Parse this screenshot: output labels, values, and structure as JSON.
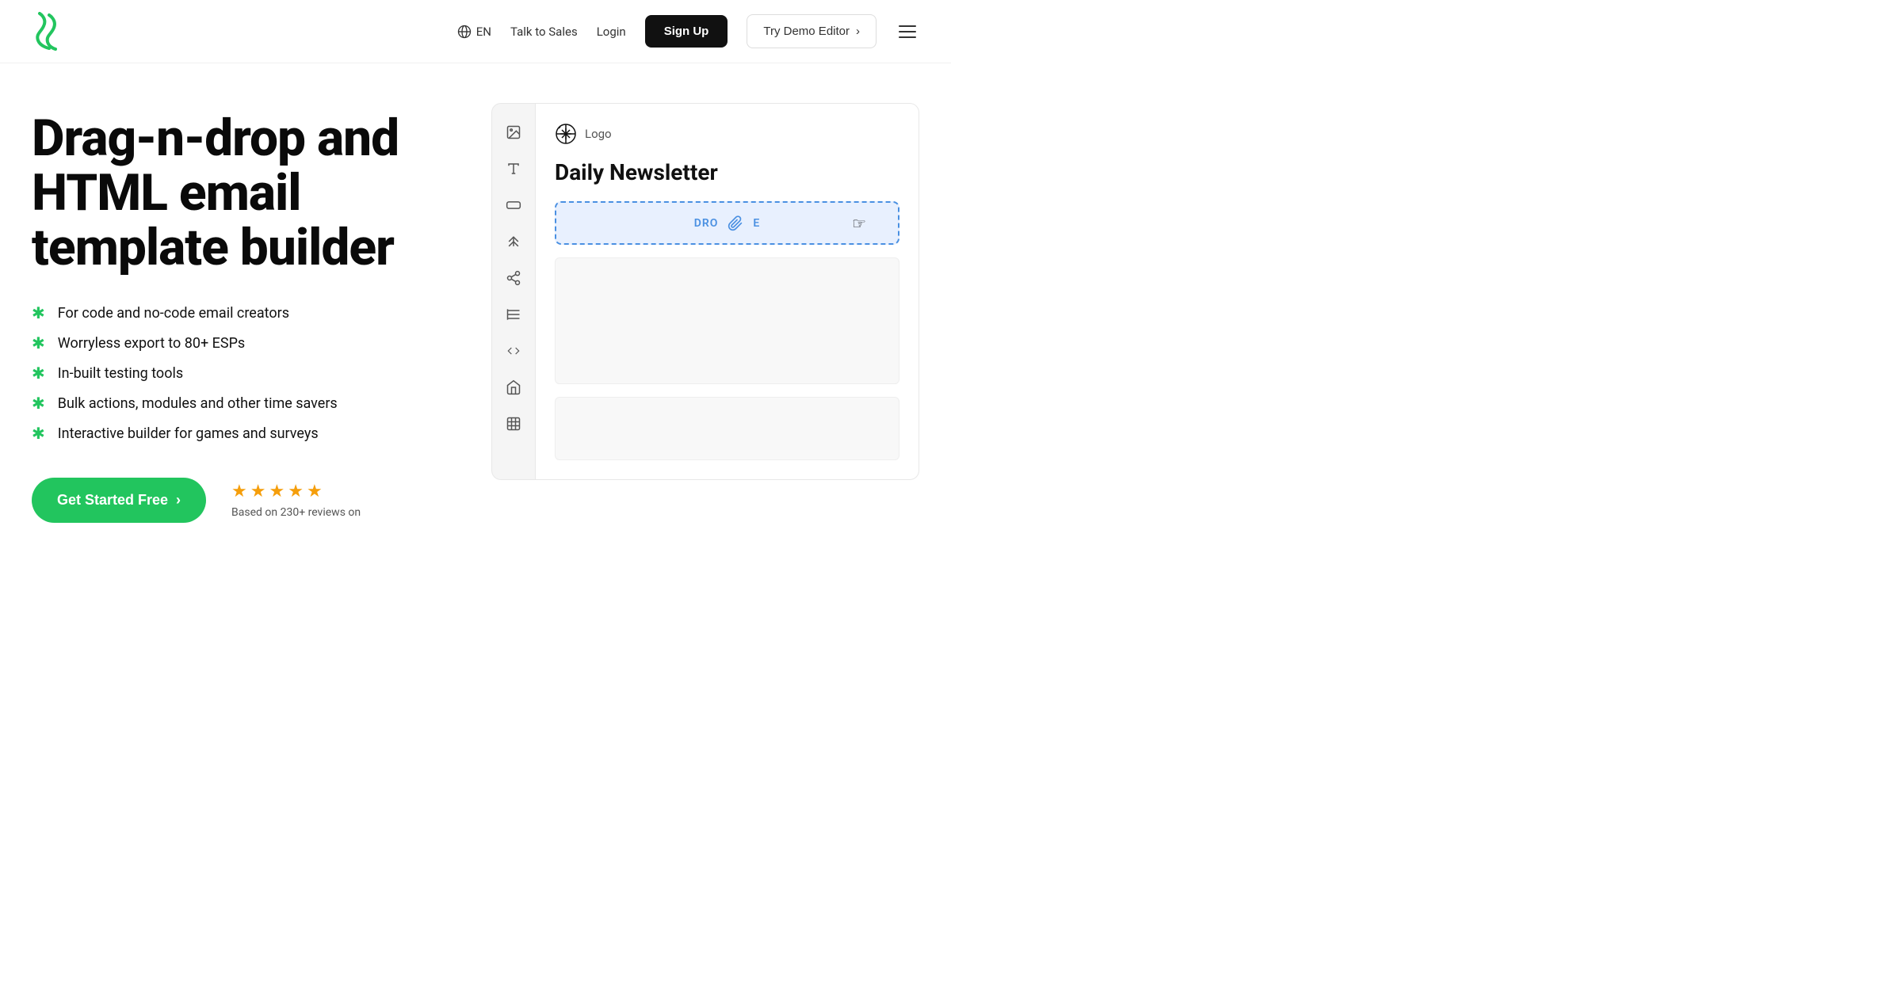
{
  "navbar": {
    "logo_alt": "Stripo logo",
    "lang_label": "EN",
    "talk_to_sales": "Talk to Sales",
    "login": "Login",
    "signup": "Sign Up",
    "try_demo": "Try Demo Editor",
    "try_demo_arrow": "›"
  },
  "hero": {
    "title": "Drag-n-drop and HTML email template builder",
    "features": [
      "For code and no-code email creators",
      "Worryless export to 80+ ESPs",
      "In-built testing tools",
      "Bulk actions, modules and other time savers",
      "Interactive builder for games and surveys"
    ],
    "cta_label": "Get Started Free",
    "cta_arrow": "›",
    "reviews_stars": "★★★★★",
    "reviews_text": "Based on 230+ reviews on"
  },
  "editor": {
    "logo_text": "Logo",
    "newsletter_title": "Daily Newsletter",
    "drop_zone_text": "DRO",
    "drop_zone_text2": "E"
  },
  "sidebar_icons": [
    {
      "name": "image-icon",
      "symbol": "🖼"
    },
    {
      "name": "text-icon",
      "symbol": "T"
    },
    {
      "name": "button-icon",
      "symbol": "▬"
    },
    {
      "name": "layout-icon",
      "symbol": "⇅"
    },
    {
      "name": "share-icon",
      "symbol": "⊳"
    },
    {
      "name": "table-icon",
      "symbol": "≡"
    },
    {
      "name": "code-icon",
      "symbol": "</>"
    },
    {
      "name": "module-icon",
      "symbol": "🏠"
    },
    {
      "name": "image2-icon",
      "symbol": "⊡"
    }
  ]
}
